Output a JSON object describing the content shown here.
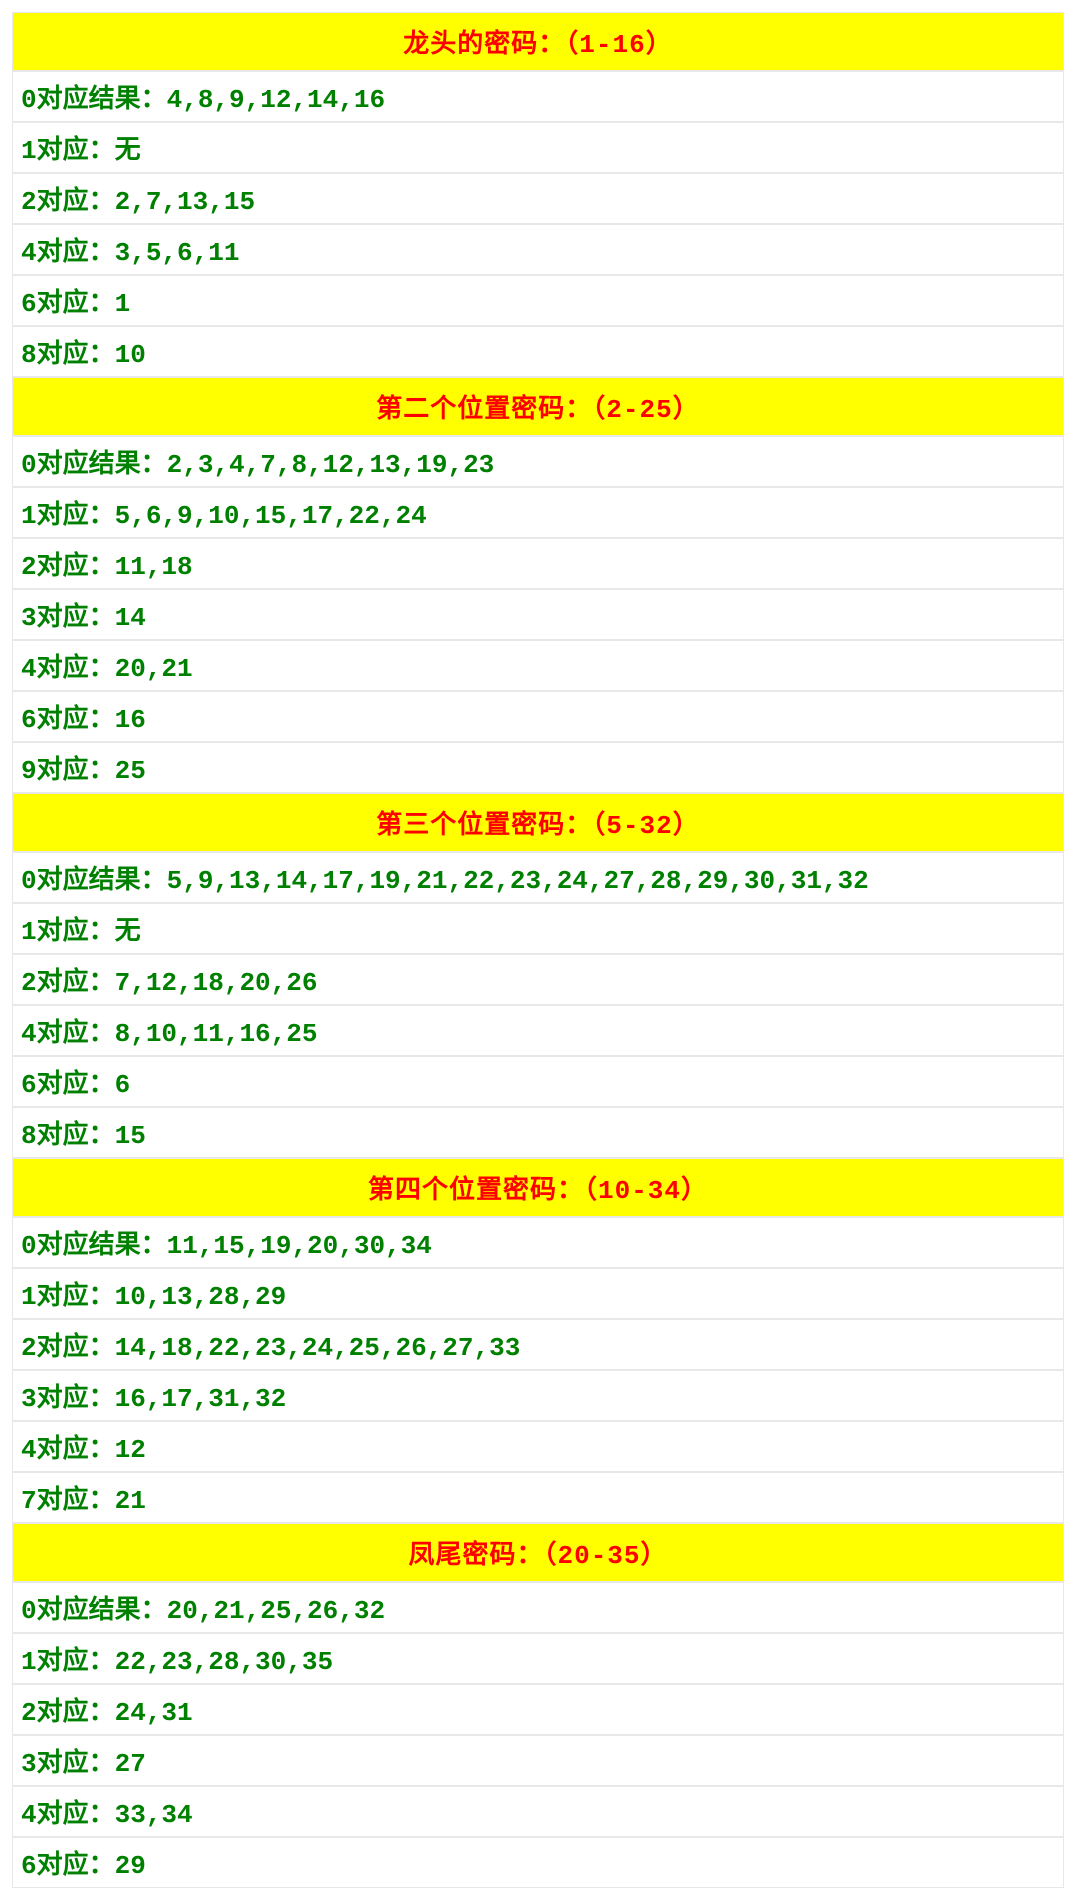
{
  "sections": [
    {
      "title": "龙头的密码：（1-16）",
      "rows": [
        {
          "key": "0",
          "sep": "对应结果：",
          "val": "4,8,9,12,14,16"
        },
        {
          "key": "1",
          "sep": "对应：",
          "val": "无"
        },
        {
          "key": "2",
          "sep": "对应：",
          "val": "2,7,13,15"
        },
        {
          "key": "4",
          "sep": "对应：",
          "val": "3,5,6,11"
        },
        {
          "key": "6",
          "sep": "对应：",
          "val": "1"
        },
        {
          "key": "8",
          "sep": "对应：",
          "val": "10"
        }
      ]
    },
    {
      "title": "第二个位置密码：（2-25）",
      "rows": [
        {
          "key": "0",
          "sep": "对应结果：",
          "val": "2,3,4,7,8,12,13,19,23"
        },
        {
          "key": "1",
          "sep": "对应：",
          "val": "5,6,9,10,15,17,22,24"
        },
        {
          "key": "2",
          "sep": "对应：",
          "val": "11,18"
        },
        {
          "key": "3",
          "sep": "对应：",
          "val": "14"
        },
        {
          "key": "4",
          "sep": "对应：",
          "val": "20,21"
        },
        {
          "key": "6",
          "sep": "对应：",
          "val": "16"
        },
        {
          "key": "9",
          "sep": "对应：",
          "val": "25"
        }
      ]
    },
    {
      "title": "第三个位置密码：（5-32）",
      "rows": [
        {
          "key": "0",
          "sep": "对应结果：",
          "val": "5,9,13,14,17,19,21,22,23,24,27,28,29,30,31,32"
        },
        {
          "key": "1",
          "sep": "对应：",
          "val": "无"
        },
        {
          "key": "2",
          "sep": "对应：",
          "val": "7,12,18,20,26"
        },
        {
          "key": "4",
          "sep": "对应：",
          "val": "8,10,11,16,25"
        },
        {
          "key": "6",
          "sep": "对应：",
          "val": "6"
        },
        {
          "key": "8",
          "sep": "对应：",
          "val": "15"
        }
      ]
    },
    {
      "title": "第四个位置密码：（10-34）",
      "rows": [
        {
          "key": "0",
          "sep": "对应结果：",
          "val": "11,15,19,20,30,34"
        },
        {
          "key": "1",
          "sep": "对应：",
          "val": "10,13,28,29"
        },
        {
          "key": "2",
          "sep": "对应：",
          "val": "14,18,22,23,24,25,26,27,33"
        },
        {
          "key": "3",
          "sep": "对应：",
          "val": "16,17,31,32"
        },
        {
          "key": "4",
          "sep": "对应：",
          "val": "12"
        },
        {
          "key": "7",
          "sep": "对应：",
          "val": "21"
        }
      ]
    },
    {
      "title": "凤尾密码：（20-35）",
      "rows": [
        {
          "key": "0",
          "sep": "对应结果：",
          "val": "20,21,25,26,32"
        },
        {
          "key": "1",
          "sep": "对应：",
          "val": "22,23,28,30,35"
        },
        {
          "key": "2",
          "sep": "对应：",
          "val": "24,31"
        },
        {
          "key": "3",
          "sep": "对应：",
          "val": "27"
        },
        {
          "key": "4",
          "sep": "对应：",
          "val": "33,34"
        },
        {
          "key": "6",
          "sep": "对应：",
          "val": "29"
        }
      ]
    }
  ]
}
